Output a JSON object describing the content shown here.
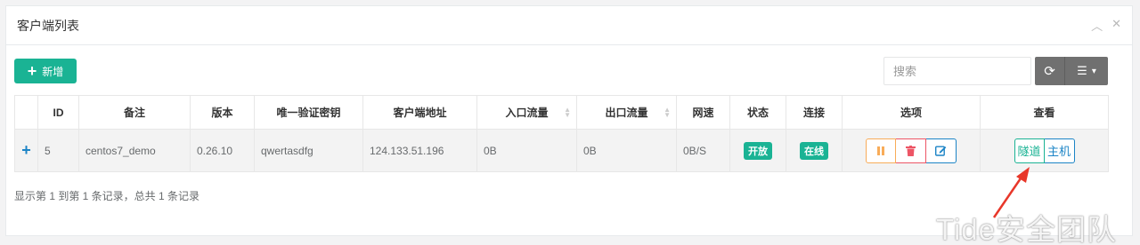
{
  "panel": {
    "title": "客户端列表",
    "collapse_icon": "chevron-up-icon",
    "close_icon": "close-icon",
    "collapse_glyph": "︿",
    "close_glyph": "✕"
  },
  "toolbar": {
    "add_label": "新增",
    "add_glyph": "+",
    "search_placeholder": "搜索",
    "refresh_glyph": "⟳",
    "columns_glyph": "☰",
    "columns_caret": "▾"
  },
  "table": {
    "columns": [
      "",
      "ID",
      "备注",
      "版本",
      "唯一验证密钥",
      "客户端地址",
      "入口流量",
      "出口流量",
      "网速",
      "状态",
      "连接",
      "选项",
      "查看"
    ],
    "rows": [
      {
        "expand": "+",
        "id": "5",
        "remark": "centos7_demo",
        "version": "0.26.10",
        "key": "qwertasdfg",
        "address": "124.133.51.196",
        "in_flow": "0B",
        "out_flow": "0B",
        "speed": "0B/S",
        "status": "开放",
        "connection": "在线",
        "option_icons": [
          "pause-icon",
          "trash-icon",
          "edit-icon"
        ],
        "view_tunnel": "隧道",
        "view_host": "主机"
      }
    ]
  },
  "pagination": {
    "info": "显示第 1 到第 1 条记录，总共 1 条记录"
  },
  "watermark": "Tide安全团队",
  "colors": {
    "primary": "#1ab394",
    "info": "#1c84c6",
    "warning": "#f8ac59",
    "danger": "#ed5565",
    "annotation": "#e8372a"
  }
}
